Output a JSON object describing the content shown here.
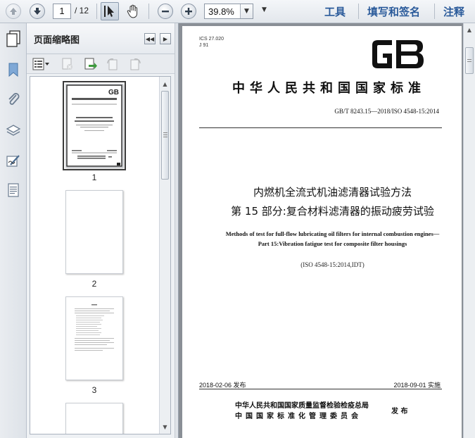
{
  "toolbar": {
    "current_page": "1",
    "total_pages": "/ 12",
    "zoom": "39.8%",
    "links": [
      "工具",
      "填写和签名",
      "注释"
    ]
  },
  "nav_icons": [
    "bookmark-icon",
    "attachment-icon",
    "layers-icon",
    "signature-icon",
    "page-content-icon"
  ],
  "thumbnail_panel": {
    "title": "页面缩略图",
    "pages": [
      "1",
      "2",
      "3"
    ]
  },
  "document": {
    "ics": "ICS 27.020",
    "ccs": "J 91",
    "logo": "GB",
    "standard_title": "中华人民共和国国家标准",
    "code": "GB/T 8243.15—2018/ISO 4548-15:2014",
    "cn_title_1": "内燃机全流式机油滤清器试验方法",
    "cn_title_2": "第 15 部分:复合材料滤清器的振动疲劳试验",
    "en_title_1": "Methods of test for full-flow lubricating oil filters for internal combustion engines—",
    "en_title_2": "Part 15:Vibration fatigue test for composite filter housings",
    "iso_ref": "(ISO 4548-15:2014,IDT)",
    "publish_date": "2018-02-06 发布",
    "implement_date": "2018-09-01 实施",
    "issuer_1": "中华人民共和国国家质量监督检验检疫总局",
    "issuer_2": "中国国家标准化管理委员会",
    "issue_word": "发 布"
  }
}
